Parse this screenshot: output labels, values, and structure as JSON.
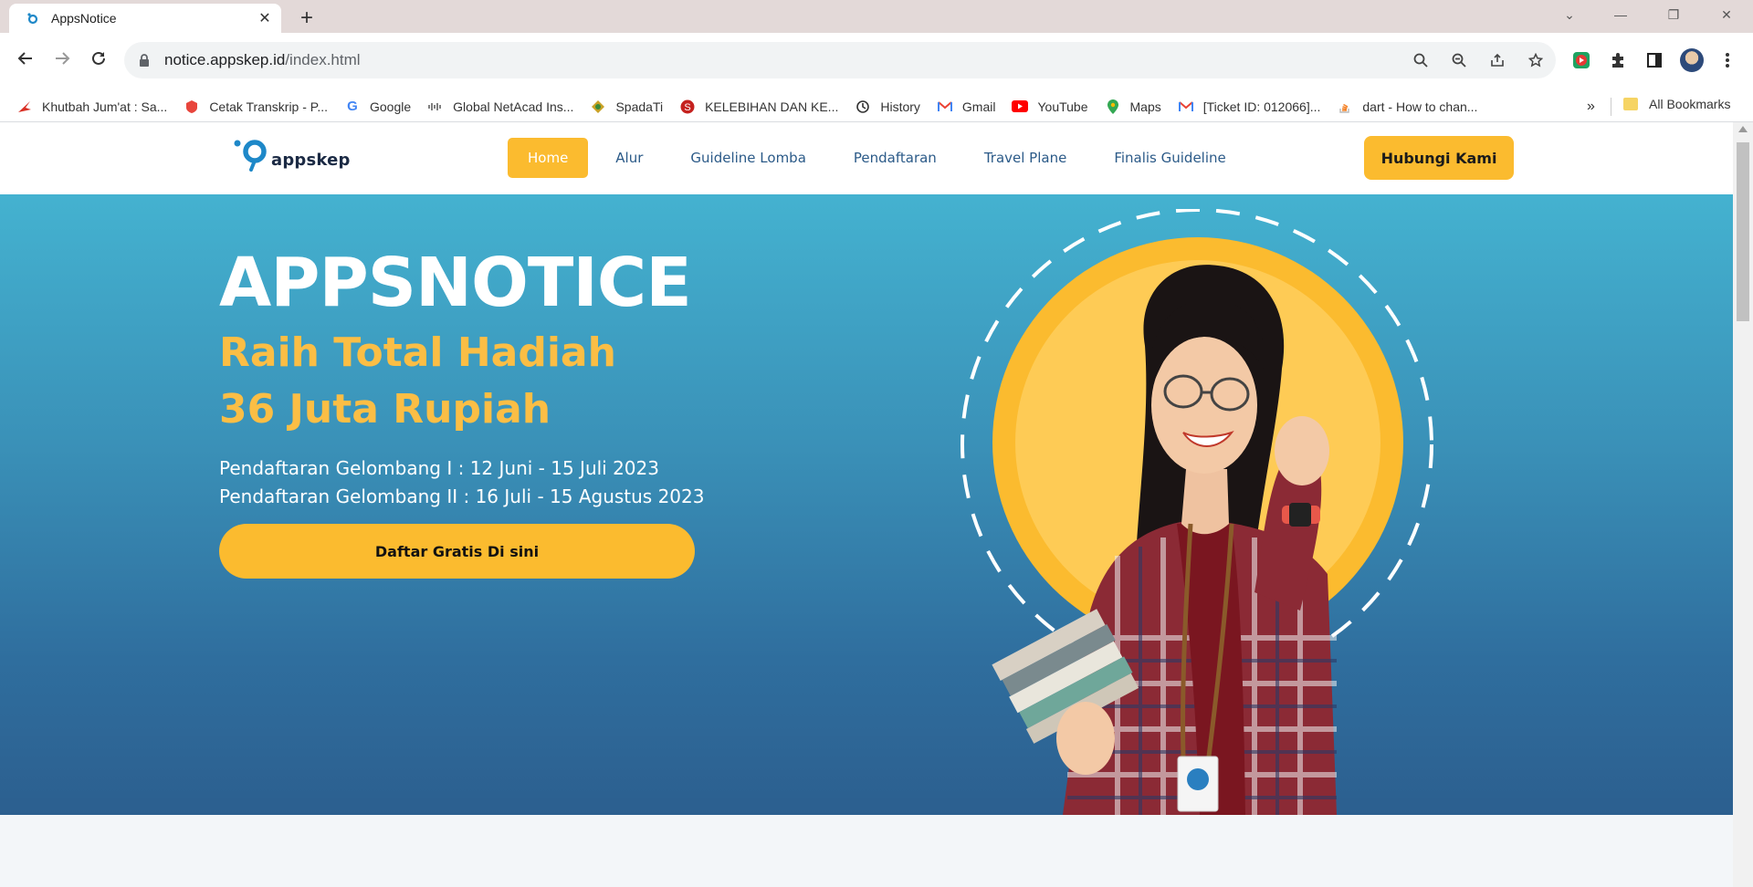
{
  "browser": {
    "tab_title": "AppsNotice",
    "url_host": "notice.appskep.id",
    "url_path": "/index.html"
  },
  "bookmarks": [
    {
      "label": "Khutbah Jum'at : Sa...",
      "icon": "red-arrow-icon",
      "color": "#d93025"
    },
    {
      "label": "Cetak Transkrip - P...",
      "icon": "red-shield-icon",
      "color": "#e8453c"
    },
    {
      "label": "Google",
      "icon": "google-icon",
      "color": "#4285f4"
    },
    {
      "label": "Global NetAcad Ins...",
      "icon": "cisco-icon",
      "color": "#555555"
    },
    {
      "label": "SpadaTi",
      "icon": "spada-icon",
      "color": "#c9a227"
    },
    {
      "label": "KELEBIHAN DAN KE...",
      "icon": "s-circle-icon",
      "color": "#c5221f"
    },
    {
      "label": "History",
      "icon": "history-icon",
      "color": "#333333"
    },
    {
      "label": "Gmail",
      "icon": "gmail-icon",
      "color": "#ea4335"
    },
    {
      "label": "YouTube",
      "icon": "youtube-icon",
      "color": "#ff0000"
    },
    {
      "label": "Maps",
      "icon": "maps-icon",
      "color": "#34a853"
    },
    {
      "label": "[Ticket ID: 012066]...",
      "icon": "gmail-icon",
      "color": "#ea4335"
    },
    {
      "label": "dart - How to chan...",
      "icon": "stackoverflow-icon",
      "color": "#f48024"
    }
  ],
  "bookmarks_more": "»",
  "all_bookmarks": "All Bookmarks",
  "site": {
    "logo_text": "appskep",
    "nav": [
      {
        "label": "Home",
        "active": true
      },
      {
        "label": "Alur",
        "active": false
      },
      {
        "label": "Guideline Lomba",
        "active": false
      },
      {
        "label": "Pendaftaran",
        "active": false
      },
      {
        "label": "Travel Plane",
        "active": false
      },
      {
        "label": "Finalis Guideline",
        "active": false
      }
    ],
    "cta_label": "Hubungi Kami"
  },
  "hero": {
    "title": "APPSNOTICE",
    "subtitle_line1": "Raih Total Hadiah",
    "subtitle_line2": "36 Juta Rupiah",
    "registration_1": "Pendaftaran Gelombang I : 12 Juni - 15 Juli 2023",
    "registration_2": "Pendaftaran Gelombang II : 16 Juli - 15 Agustus 2023",
    "button_label": "Daftar Gratis Di sini"
  },
  "colors": {
    "accent": "#fbbb2f",
    "nav_text": "#2b5a88",
    "hero_top": "#44b2d0",
    "hero_bottom": "#2c5f8f"
  }
}
